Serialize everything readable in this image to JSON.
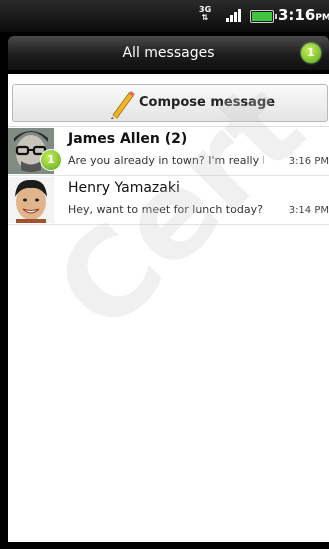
{
  "status_bar": {
    "network": "3G",
    "time": "3:16",
    "ampm": "PM",
    "icons": [
      "network-3g-icon",
      "signal-icon",
      "battery-icon"
    ]
  },
  "title_bar": {
    "title": "All messages",
    "unread_count": "1"
  },
  "compose": {
    "label": "Compose message",
    "icon": "pencil-icon"
  },
  "threads": [
    {
      "name": "James Allen (2)",
      "preview": "Are you already in town? I'm really looking forward to seeing you",
      "time": "3:16 PM",
      "unread_count": "1",
      "bold": true
    },
    {
      "name": "Henry Yamazaki",
      "preview": "Hey, want to meet for lunch today?",
      "time": "3:14 PM",
      "bold": false
    }
  ],
  "watermark": "Cert",
  "colors": {
    "accent_green": "#6cc21f",
    "battery_green": "#3fc43f",
    "title_bar_dark": "#1d1d1d"
  }
}
